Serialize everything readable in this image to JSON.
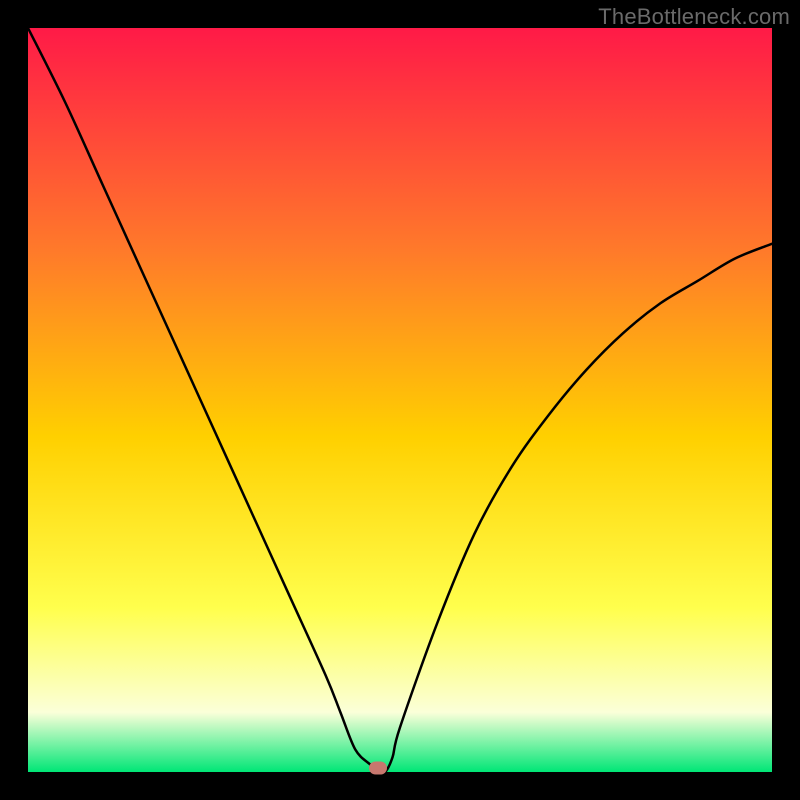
{
  "watermark": "TheBottleneck.com",
  "colors": {
    "black": "#000000",
    "gradient_top": "#ff1a47",
    "gradient_upper_mid": "#ff7a2a",
    "gradient_mid": "#ffd000",
    "gradient_lower_mid": "#ffff4d",
    "gradient_pale": "#fbffd9",
    "gradient_bottom": "#00e676",
    "curve": "#000000",
    "marker": "#c7776e"
  },
  "chart_data": {
    "type": "line",
    "title": "",
    "xlabel": "",
    "ylabel": "",
    "xlim": [
      0,
      100
    ],
    "ylim": [
      0,
      100
    ],
    "x": [
      0,
      5,
      10,
      15,
      20,
      25,
      30,
      35,
      40,
      42,
      44,
      46,
      47,
      48,
      49,
      50,
      55,
      60,
      65,
      70,
      75,
      80,
      85,
      90,
      95,
      100
    ],
    "values": [
      100,
      90,
      79,
      68,
      57,
      46,
      35,
      24,
      13,
      8,
      3,
      1,
      0,
      0,
      2,
      6,
      20,
      32,
      41,
      48,
      54,
      59,
      63,
      66,
      69,
      71
    ],
    "marker": {
      "x": 47,
      "y": 0
    },
    "annotations": []
  }
}
